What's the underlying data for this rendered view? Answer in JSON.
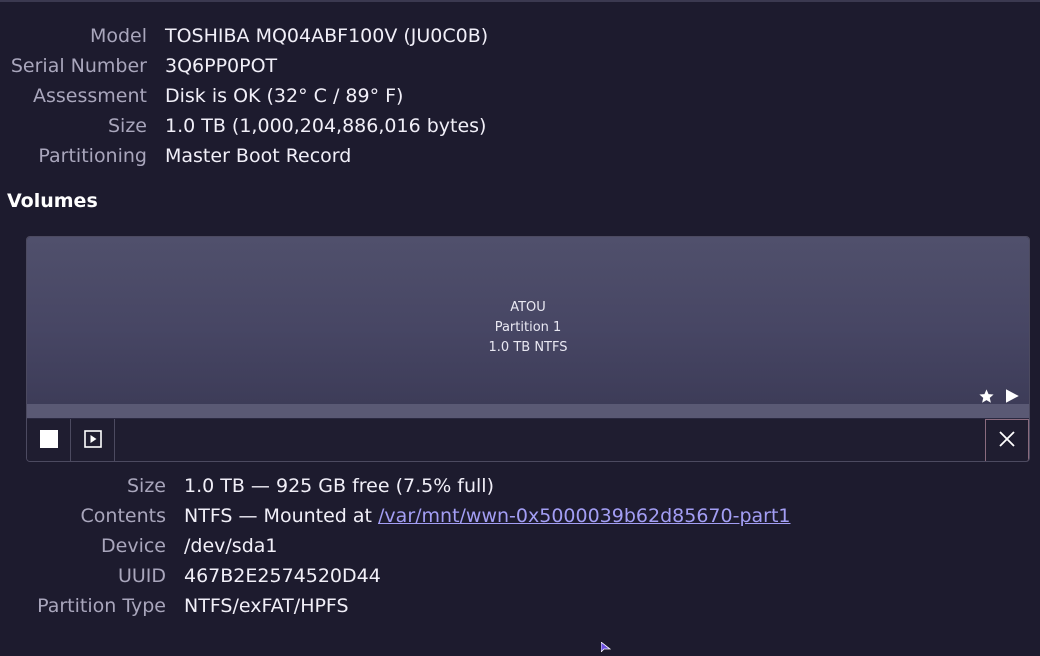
{
  "disk": {
    "model_label": "Model",
    "model": "TOSHIBA MQ04ABF100V (JU0C0B)",
    "serial_label": "Serial Number",
    "serial": "3Q6PP0POT",
    "assessment_label": "Assessment",
    "assessment": "Disk is OK (32° C / 89° F)",
    "size_label": "Size",
    "size": "1.0 TB (1,000,204,886,016 bytes)",
    "partitioning_label": "Partitioning",
    "partitioning": "Master Boot Record"
  },
  "volumes": {
    "title": "Volumes",
    "block": {
      "name": "ATOU",
      "partition": "Partition 1",
      "summary": "1.0 TB NTFS"
    },
    "toolbar": {
      "stop_icon": "stop-icon",
      "mount_icon": "mount-play-icon",
      "close_icon": "close-icon"
    }
  },
  "partition": {
    "size_label": "Size",
    "size": "1.0 TB — 925 GB free (7.5% full)",
    "contents_label": "Contents",
    "contents_prefix": "NTFS — Mounted at ",
    "mount_path": "/var/mnt/wwn-0x5000039b62d85670-part1",
    "device_label": "Device",
    "device": "/dev/sda1",
    "uuid_label": "UUID",
    "uuid": "467B2E2574520D44",
    "type_label": "Partition Type",
    "type": "NTFS/exFAT/HPFS"
  },
  "colors": {
    "background": "#1d1b2e",
    "volume_block": "#4a4966",
    "link": "#a39ef4",
    "close_border": "#8a6b7e"
  }
}
